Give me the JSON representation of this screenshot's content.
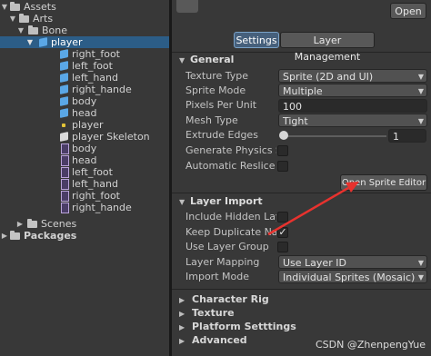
{
  "project": {
    "tree": [
      {
        "label": "Assets",
        "kind": "folder-open",
        "expanded": true
      },
      {
        "label": "Arts",
        "kind": "folder-open",
        "expanded": true
      },
      {
        "label": "Bone",
        "kind": "folder-open",
        "expanded": true
      },
      {
        "label": "player",
        "kind": "cube",
        "expanded": true,
        "selected": true
      },
      {
        "label": "right_foot",
        "kind": "cube"
      },
      {
        "label": "left_foot",
        "kind": "cube"
      },
      {
        "label": "left_hand",
        "kind": "cube"
      },
      {
        "label": "right_hande",
        "kind": "cube"
      },
      {
        "label": "body",
        "kind": "cube"
      },
      {
        "label": "head",
        "kind": "cube"
      },
      {
        "label": "player",
        "kind": "dot"
      },
      {
        "label": "player Skeleton",
        "kind": "cube-white"
      },
      {
        "label": "body",
        "kind": "sprite"
      },
      {
        "label": "head",
        "kind": "sprite"
      },
      {
        "label": "left_foot",
        "kind": "sprite"
      },
      {
        "label": "left_hand",
        "kind": "sprite"
      },
      {
        "label": "right_foot",
        "kind": "sprite"
      },
      {
        "label": "right_hande",
        "kind": "sprite"
      },
      {
        "label": "Scenes",
        "kind": "folder",
        "expanded": false
      },
      {
        "label": "Packages",
        "kind": "folder",
        "expanded": false
      }
    ]
  },
  "inspector": {
    "open_label": "Open",
    "tabs": {
      "settings": "Settings",
      "layer_management": "Layer Management"
    },
    "general": {
      "title": "General",
      "texture_type": {
        "label": "Texture Type",
        "value": "Sprite (2D and UI)"
      },
      "sprite_mode": {
        "label": "Sprite Mode",
        "value": "Multiple"
      },
      "ppu": {
        "label": "Pixels Per Unit",
        "value": "100"
      },
      "mesh_type": {
        "label": "Mesh Type",
        "value": "Tight"
      },
      "extrude": {
        "label": "Extrude Edges",
        "value": "1",
        "fraction": 0.0
      },
      "physics": {
        "label": "Generate Physics Sh",
        "checked": false
      },
      "reslice": {
        "label": "Automatic Reslice",
        "checked": false
      },
      "open_editor": "Open Sprite Editor"
    },
    "layer_import": {
      "title": "Layer Import",
      "include_hidden": {
        "label": "Include Hidden Laye",
        "checked": false
      },
      "keep_dup": {
        "label": "Keep Duplicate Nam",
        "checked": true
      },
      "use_group": {
        "label": "Use Layer Group",
        "checked": false
      },
      "layer_mapping": {
        "label": "Layer Mapping",
        "value": "Use Layer ID"
      },
      "import_mode": {
        "label": "Import Mode",
        "value": "Individual Sprites (Mosaic)"
      }
    },
    "collapsed": {
      "character_rig": "Character Rig",
      "texture": "Texture",
      "platform": "Platform Setttings",
      "advanced": "Advanced"
    },
    "check_glyph": "✓",
    "watermark": "CSDN @ZhenpengYue"
  },
  "colors": {
    "selection": "#2c5d87",
    "arrow": "#e8322e",
    "panel": "#383838"
  }
}
